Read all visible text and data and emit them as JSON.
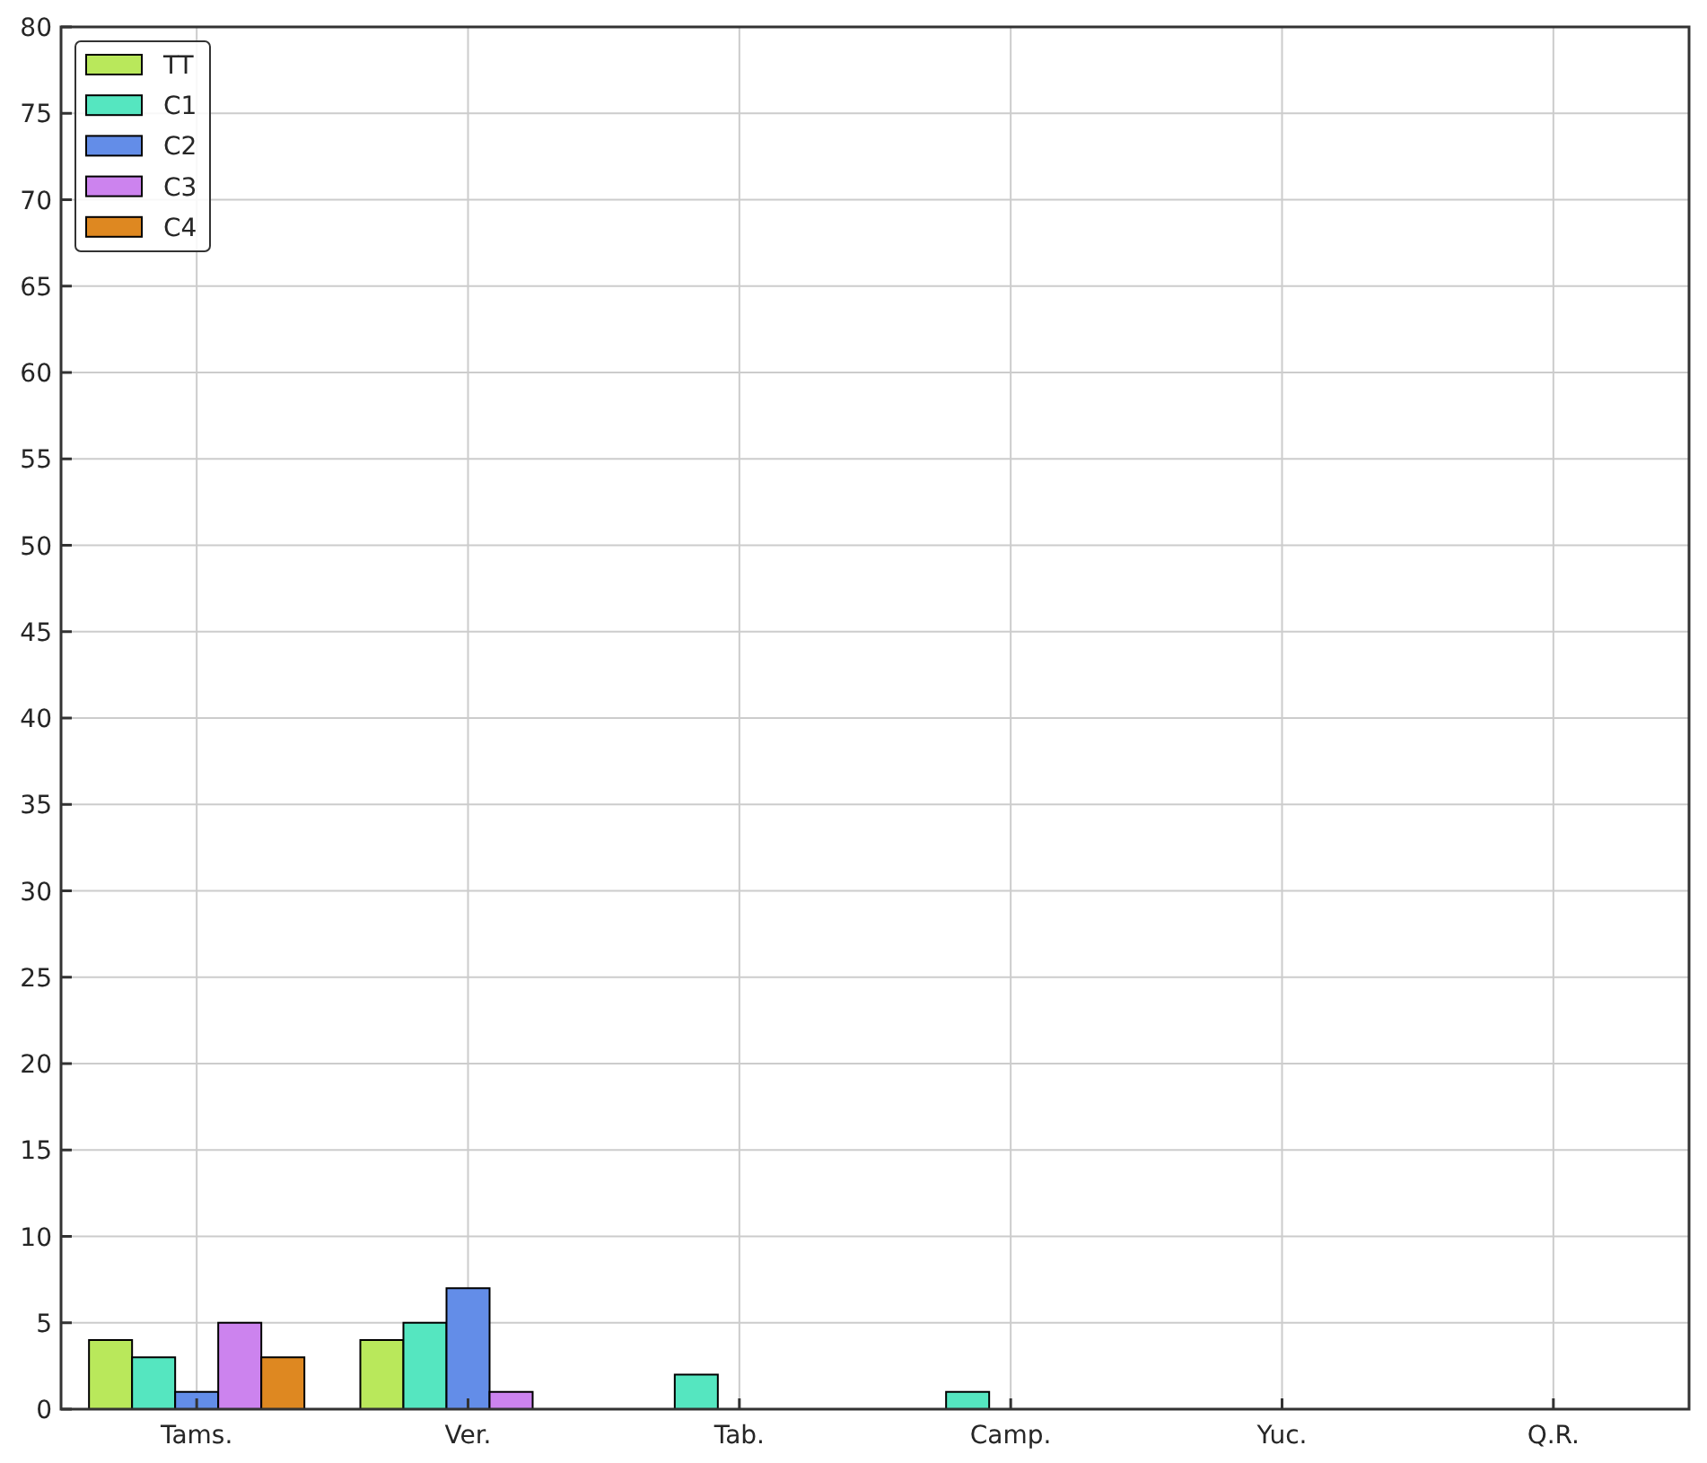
{
  "chart_data": {
    "type": "bar",
    "categories": [
      "Tams.",
      "Ver.",
      "Tab.",
      "Camp.",
      "Yuc.",
      "Q.R."
    ],
    "series": [
      {
        "name": "TT",
        "color": "#b9e85b",
        "values": [
          4,
          4,
          0,
          0,
          0,
          0
        ]
      },
      {
        "name": "C1",
        "color": "#55e6c0",
        "values": [
          3,
          5,
          2,
          1,
          0,
          0
        ]
      },
      {
        "name": "C2",
        "color": "#638de8",
        "values": [
          1,
          7,
          0,
          0,
          0,
          0
        ]
      },
      {
        "name": "C3",
        "color": "#cc83ee",
        "values": [
          5,
          1,
          0,
          0,
          0,
          0
        ]
      },
      {
        "name": "C4",
        "color": "#de8821",
        "values": [
          3,
          0,
          0,
          0,
          0,
          0
        ]
      }
    ],
    "grid": true,
    "legend": true,
    "ylim": [
      0,
      80
    ],
    "yticks": [
      0,
      5,
      10,
      15,
      20,
      25,
      30,
      35,
      40,
      45,
      50,
      55,
      60,
      65,
      70,
      75,
      80
    ]
  }
}
